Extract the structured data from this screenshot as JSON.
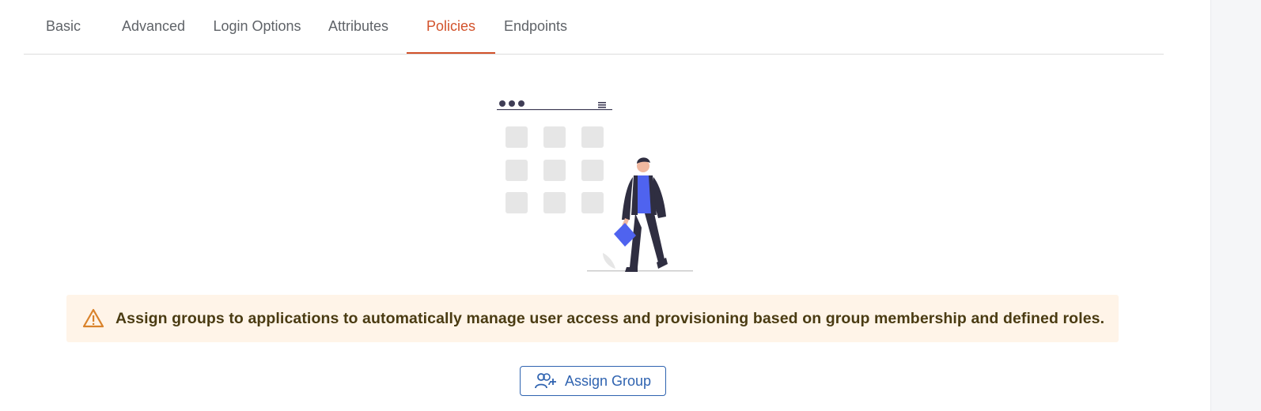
{
  "tabs": [
    {
      "label": "Basic"
    },
    {
      "label": "Advanced"
    },
    {
      "label": "Login Options"
    },
    {
      "label": "Attributes"
    },
    {
      "label": "Policies"
    },
    {
      "label": "Endpoints"
    }
  ],
  "active_tab": "Policies",
  "illustration": {
    "icon": "empty-state-person-walking-illustration"
  },
  "alert": {
    "icon": "warning-triangle-icon",
    "message": "Assign groups to applications to automatically manage user access and provisioning based on group membership and defined roles."
  },
  "assign_button": {
    "label": "Assign Group",
    "icon": "user-plus-icon"
  },
  "colors": {
    "accent": "#d2522b",
    "primary": "#2f63b0",
    "alert_bg": "#fff4e8",
    "warning": "#d9822b",
    "figure_shirt": "#4f63ef"
  }
}
